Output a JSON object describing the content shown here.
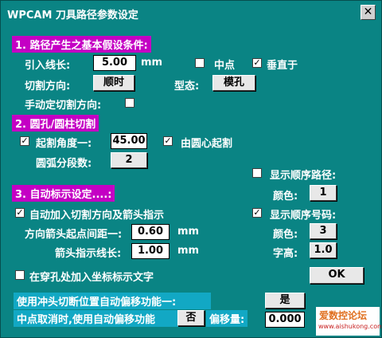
{
  "window": {
    "title": "WPCAM 刀具路径参数设定",
    "close_glyph": "✕"
  },
  "section1": {
    "heading": "1. 路径产生之基本假设条件:",
    "lead_in_label": "引入线长:",
    "lead_in_value": "5.00",
    "lead_in_unit": "mm",
    "midpoint_label": "中点",
    "midpoint_checked": false,
    "perpendicular_label": "垂直于",
    "perpendicular_checked": true,
    "cut_direction_label": "切割方向:",
    "cut_direction_value": "顺时",
    "shape_label": "型态:",
    "shape_value": "模孔",
    "manual_direction_label": "手动定切割方向:",
    "manual_direction_checked": false
  },
  "section2": {
    "heading": "2. 圆孔/圆柱切割",
    "start_angle_label": "起割角度一:",
    "start_angle_checked": true,
    "start_angle_value": "45.00",
    "from_center_label": "由圆心起割",
    "from_center_checked": true,
    "arc_segments_label": "圆弧分段数:",
    "arc_segments_value": "2"
  },
  "sequence_path": {
    "label": "显示顺序路径:",
    "checked": false,
    "color_label": "颜色:",
    "color_value": "1"
  },
  "section3": {
    "heading": "3. 自动标示设定....:",
    "auto_arrow_label": "自动加入切割方向及箭头指示",
    "auto_arrow_checked": true,
    "arrow_offset_label": "方向箭头起点间距一:",
    "arrow_offset_value": "0.60",
    "arrow_offset_unit": "mm",
    "arrow_length_label": "箭头指示线长:",
    "arrow_length_value": "1.00",
    "arrow_length_unit": "mm",
    "pierce_label": "在穿孔处加入坐标标示文字",
    "pierce_checked": false
  },
  "sequence_number": {
    "label": "显示顺序号码:",
    "checked": true,
    "color_label": "颜色:",
    "color_value": "3",
    "font_size_label": "字高:",
    "font_size_value": "1.0"
  },
  "ok_label": "OK",
  "punch_offset": {
    "label": "使用冲头切断位置自动偏移功能一:",
    "value": "是"
  },
  "midpoint_cancel": {
    "label": "中点取消时,使用自动偏移功能",
    "value": "否",
    "offset_label": "偏移量:",
    "offset_value": "0.000"
  },
  "watermark": {
    "text": "爱数控论坛",
    "url": "www.aishukong.com"
  },
  "colors": {
    "background": "#0a8484",
    "section_heading": "#c400c4",
    "cyan_label": "#12a8c4"
  }
}
